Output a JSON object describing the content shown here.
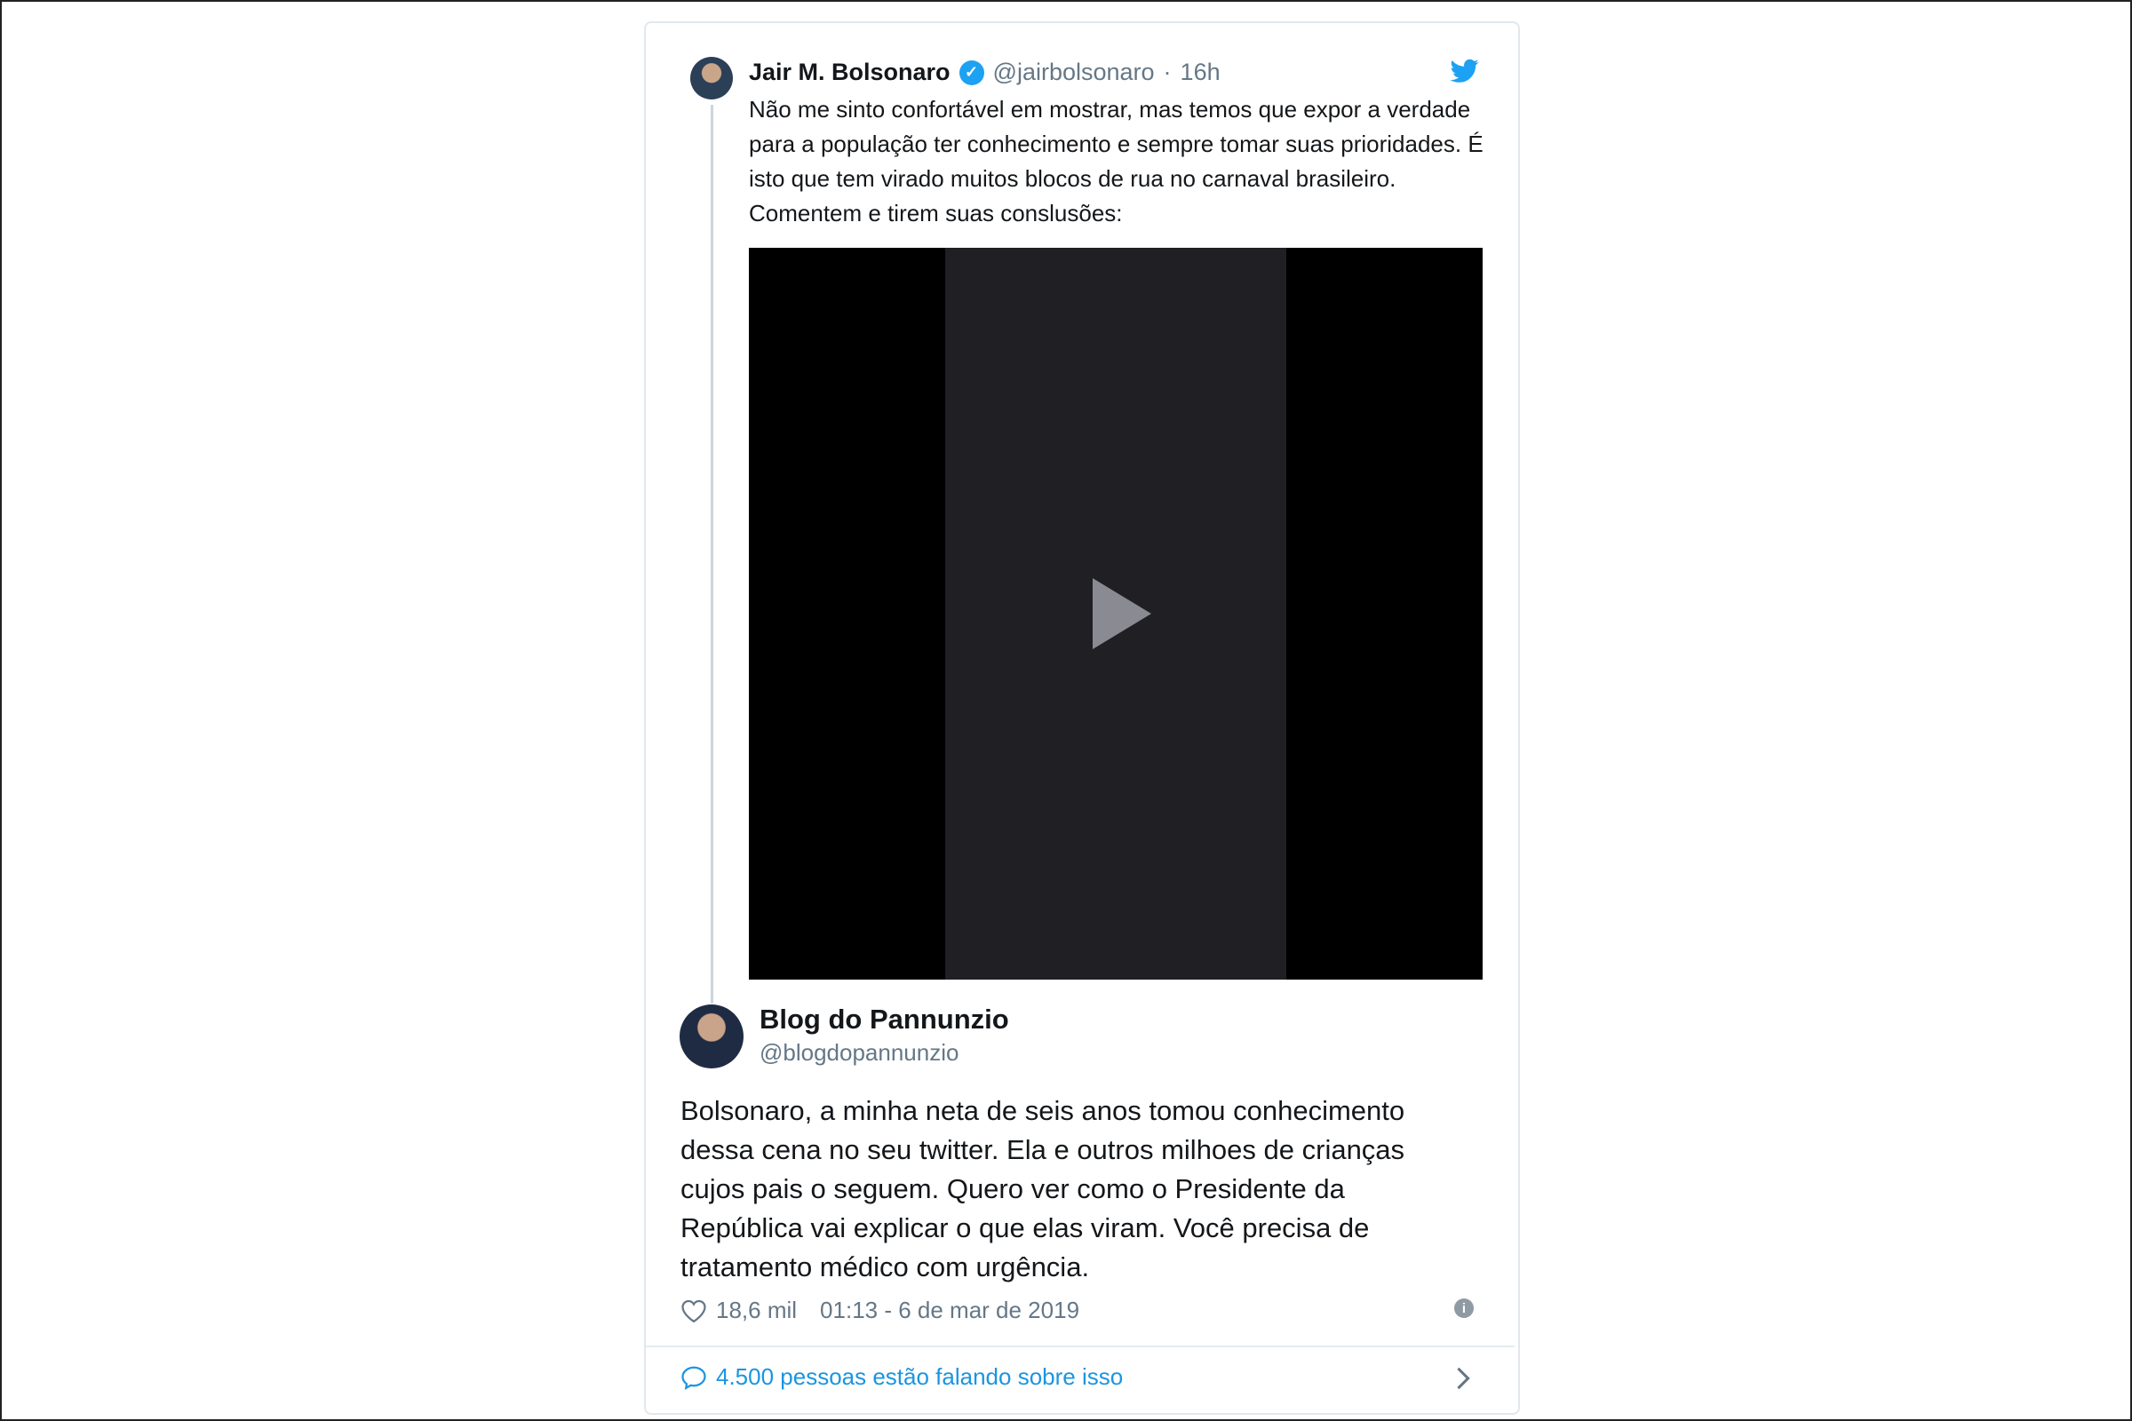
{
  "quoted_tweet": {
    "author_name": "Jair M. Bolsonaro",
    "author_handle": "@jairbolsonaro",
    "separator": "·",
    "time": "16h",
    "text": "Não me sinto confortável em mostrar, mas temos que expor a verdade para a população ter conhecimento e sempre tomar suas prioridades. É isto que tem virado muitos blocos de rua no carnaval brasileiro. Comentem e tirem suas conslusões:"
  },
  "main_tweet": {
    "author_name": "Blog do Pannunzio",
    "author_handle": "@blogdopannunzio",
    "text": "Bolsonaro, a minha neta de seis anos tomou conhecimento dessa cena no seu twitter. Ela e outros milhoes de crianças cujos pais o seguem. Quero ver como o Presidente da República vai explicar o que elas viram. Você precisa de tratamento médico com urgência.",
    "likes": "18,6 mil",
    "timestamp": "01:13 - 6 de mar de 2019"
  },
  "conversation_link": "4.500 pessoas estão falando sobre isso",
  "colors": {
    "accent": "#1da1f2",
    "link": "#1b95e0",
    "text": "#14171a",
    "secondary": "#657786"
  },
  "icons": [
    "verified-icon",
    "twitter-bird-icon",
    "play-icon",
    "heart-icon",
    "info-icon",
    "reply-icon",
    "chevron-right-icon"
  ]
}
